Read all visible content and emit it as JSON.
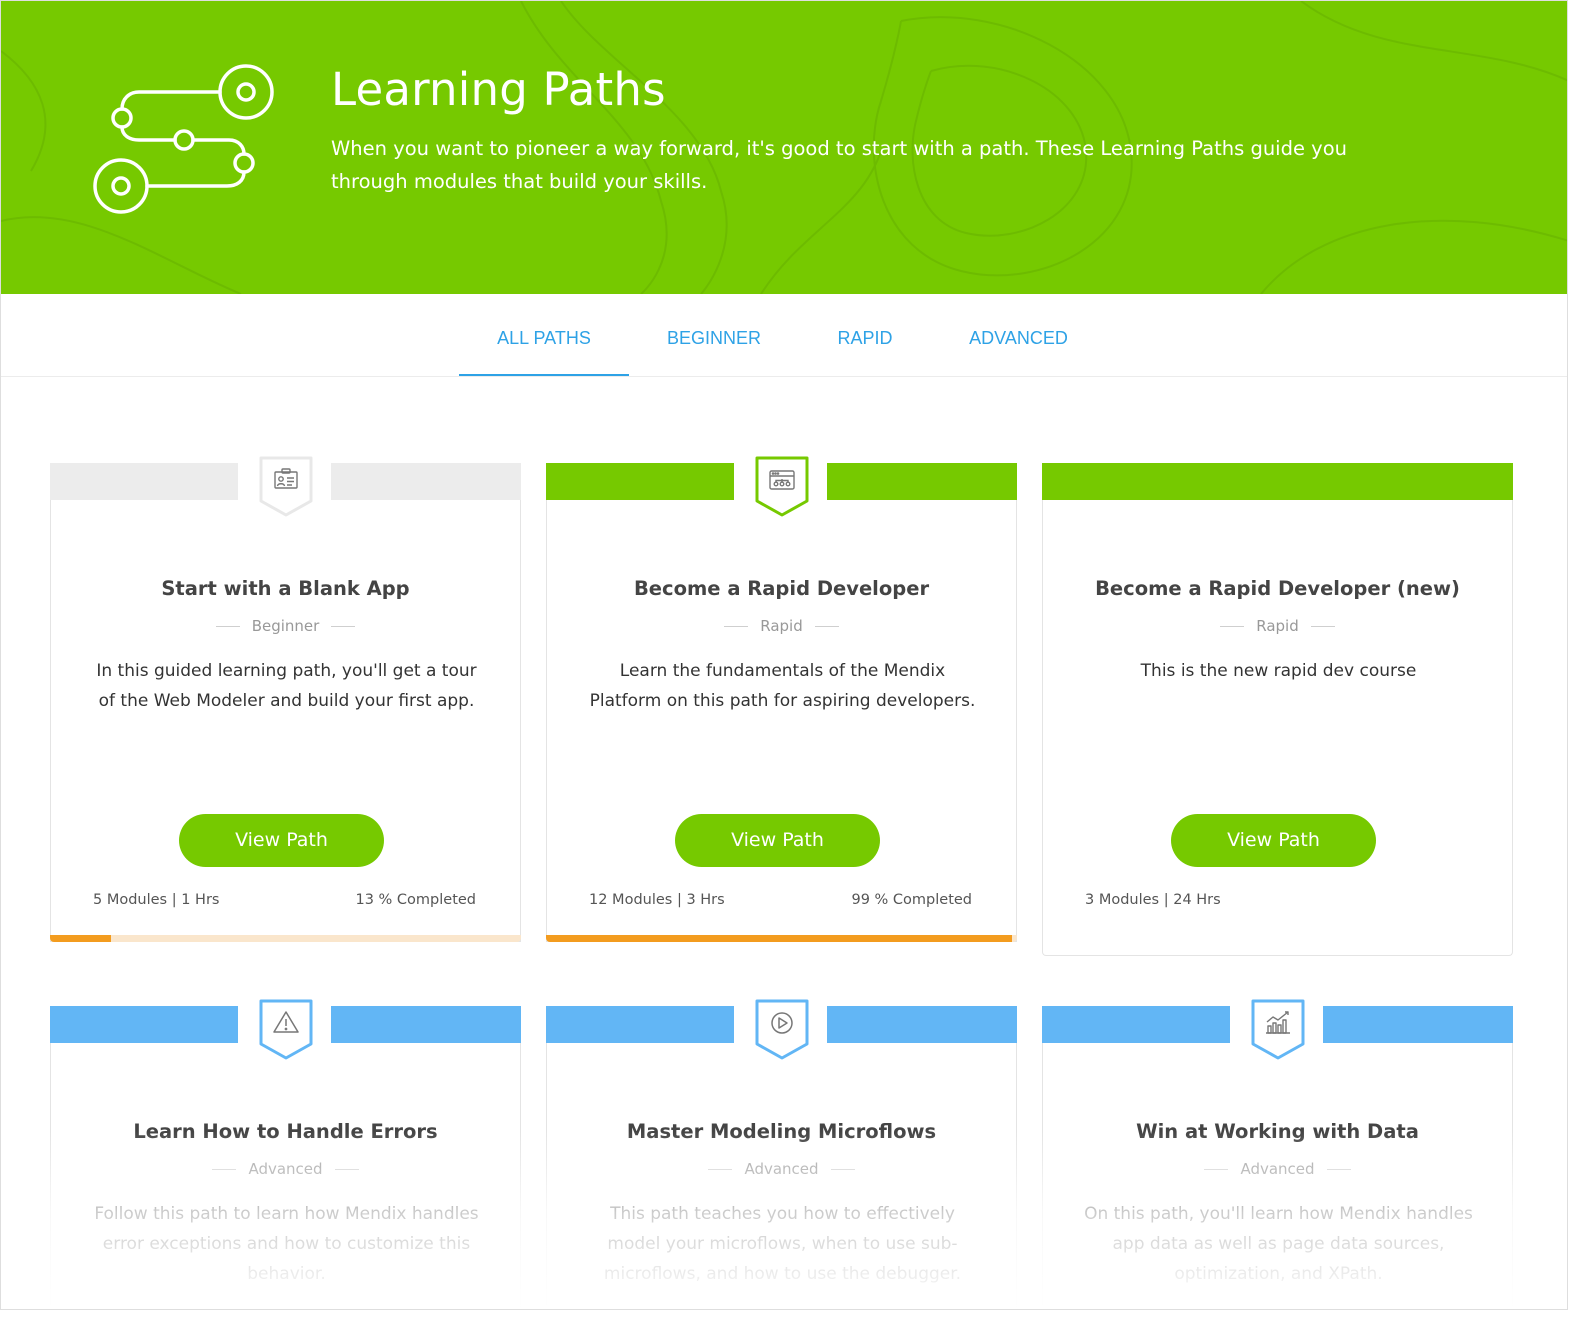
{
  "hero": {
    "title": "Learning Paths",
    "description": "When you want to pioneer a way forward, it's good to start with a path. These Learning Paths guide you through modules that build your skills.",
    "icon": "path-route-icon",
    "background_color": "#76c900"
  },
  "tabs": [
    {
      "label": "ALL PATHS",
      "active": true
    },
    {
      "label": "BEGINNER",
      "active": false
    },
    {
      "label": "RAPID",
      "active": false
    },
    {
      "label": "ADVANCED",
      "active": false
    }
  ],
  "colors": {
    "accent": "#2ea2e6",
    "green": "#76c900",
    "blue": "#62b6f5",
    "progress": "#f39c1f",
    "progress_track": "#fae6cc",
    "grey_band": "#ececec"
  },
  "cards": [
    {
      "title": "Start with a Blank App",
      "level": "Beginner",
      "description": "In this guided learning path, you'll get a tour of the Web Modeler and build your first app.",
      "button": "View Path",
      "stats": "5 Modules | 1 Hrs",
      "completed": "13 % Completed",
      "progress_percent": 13,
      "icon": "id-card-icon",
      "band": "grey"
    },
    {
      "title": "Become a Rapid Developer",
      "level": "Rapid",
      "description": "Learn the fundamentals of the Mendix Platform on this path for aspiring developers.",
      "button": "View Path",
      "stats": "12 Modules | 3 Hrs",
      "completed": "99 % Completed",
      "progress_percent": 99,
      "icon": "app-window-icon",
      "band": "green"
    },
    {
      "title": "Become a Rapid Developer (new)",
      "level": "Rapid",
      "description": "This is the new rapid dev course",
      "button": "View Path",
      "stats": "3 Modules | 24 Hrs",
      "band": "green"
    },
    {
      "title": "Learn How to Handle Errors",
      "level": "Advanced",
      "description": "Follow this path to learn how Mendix handles error exceptions and how to customize this behavior.",
      "icon": "warning-icon",
      "band": "blue"
    },
    {
      "title": "Master Modeling Microflows",
      "level": "Advanced",
      "description": "This path teaches you how to effectively model your microflows, when to use sub-microflows, and how to use the debugger.",
      "icon": "play-icon",
      "band": "blue"
    },
    {
      "title": "Win at Working with Data",
      "level": "Advanced",
      "description": "On this path, you'll learn how Mendix handles app data as well as page data sources, optimization, and XPath.",
      "icon": "bar-chart-icon",
      "band": "blue"
    }
  ]
}
